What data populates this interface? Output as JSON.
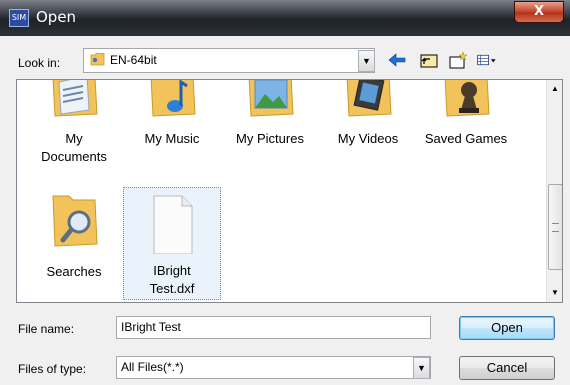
{
  "window": {
    "title": "Open",
    "app_icon_text": "SIM",
    "close_label": "X"
  },
  "lookin": {
    "label": "Look in:",
    "value": "EN-64bit"
  },
  "toolbar": {
    "icons": [
      "back-arrow-icon",
      "up-folder-icon",
      "new-folder-icon",
      "view-menu-icon"
    ]
  },
  "files": [
    {
      "label": "My\nDocuments",
      "icon": "documents-folder-icon"
    },
    {
      "label": "My Music",
      "icon": "music-folder-icon"
    },
    {
      "label": "My Pictures",
      "icon": "pictures-folder-icon"
    },
    {
      "label": "My Videos",
      "icon": "videos-folder-icon"
    },
    {
      "label": "Saved Games",
      "icon": "games-folder-icon"
    },
    {
      "label": "Searches",
      "icon": "searches-folder-icon"
    },
    {
      "label": "IBright\nTest.dxf",
      "icon": "dxf-file-icon",
      "selected": true
    }
  ],
  "filename": {
    "label": "File name:",
    "value": "IBright Test"
  },
  "filetype": {
    "label": "Files of type:",
    "value": "All Files(*.*)"
  },
  "buttons": {
    "open": "Open",
    "cancel": "Cancel"
  },
  "colors": {
    "folder": "#f2c35a",
    "selection": "#eaf3fb",
    "titlebar": "#2d3138",
    "close": "#c74b31"
  }
}
